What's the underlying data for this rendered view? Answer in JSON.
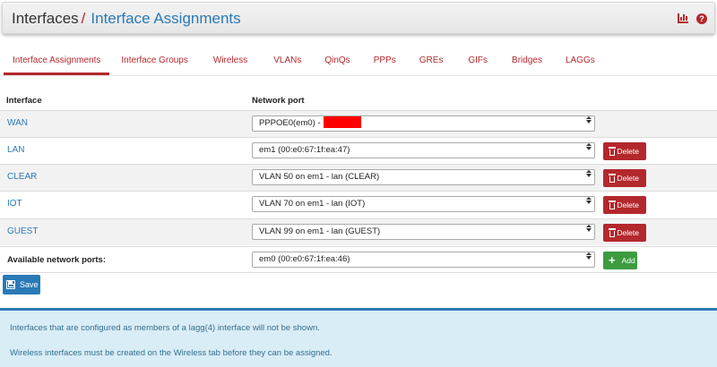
{
  "header": {
    "crumb_parent": "Interfaces",
    "separator": "/",
    "crumb_current": "Interface Assignments",
    "icons": [
      "chart-icon",
      "help-icon"
    ]
  },
  "tabs": [
    {
      "label": "Interface Assignments",
      "active": true
    },
    {
      "label": "Interface Groups",
      "active": false
    },
    {
      "label": "Wireless",
      "active": false
    },
    {
      "label": "VLANs",
      "active": false
    },
    {
      "label": "QinQs",
      "active": false
    },
    {
      "label": "PPPs",
      "active": false
    },
    {
      "label": "GREs",
      "active": false
    },
    {
      "label": "GIFs",
      "active": false
    },
    {
      "label": "Bridges",
      "active": false
    },
    {
      "label": "LAGGs",
      "active": false
    }
  ],
  "table": {
    "col_interface": "Interface",
    "col_port": "Network port",
    "rows": [
      {
        "name": "WAN",
        "port": "PPPOE0(em0) -",
        "redacted": true,
        "action": ""
      },
      {
        "name": "LAN",
        "port": "em1 (00:e0:67:1f:ea:47)",
        "action": "Delete"
      },
      {
        "name": "CLEAR",
        "port": "VLAN 50 on em1 - lan (CLEAR)",
        "action": "Delete"
      },
      {
        "name": "IOT",
        "port": "VLAN 70 on em1 - lan (IOT)",
        "action": "Delete"
      },
      {
        "name": "GUEST",
        "port": "VLAN 99 on em1 - lan (GUEST)",
        "action": "Delete"
      }
    ],
    "available": {
      "label": "Available network ports:",
      "port": "em0 (00:e0:67:1f:ea:46)",
      "action": "Add"
    }
  },
  "save_label": "Save",
  "info": {
    "line1": "Interfaces that are configured as members of a lagg(4) interface will not be shown.",
    "line2": "Wireless interfaces must be created on the Wireless tab before they can be assigned."
  },
  "colors": {
    "accent_red": "#b3282d",
    "link_blue": "#2a7ab7",
    "add_green": "#3d9c40",
    "info_bg": "#d9edf7",
    "redaction": "#ff0000"
  }
}
